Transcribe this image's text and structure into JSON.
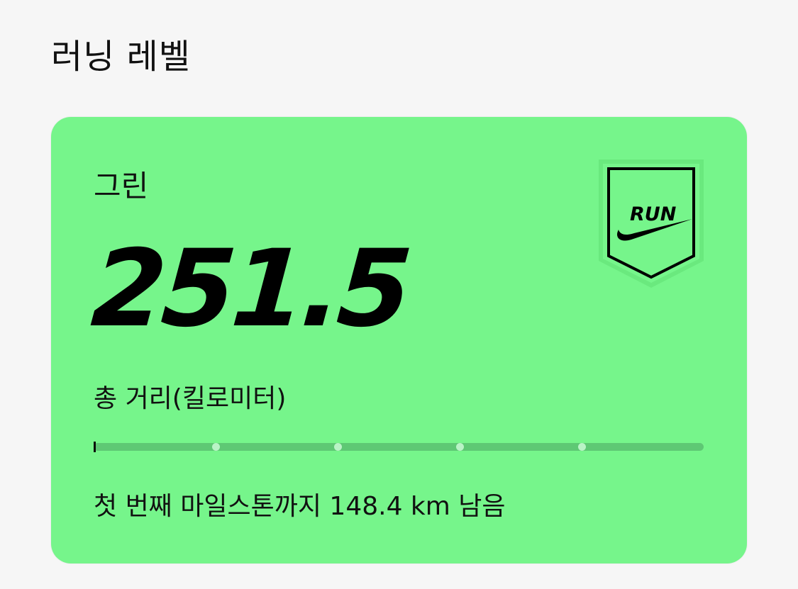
{
  "header": {
    "title": "러닝 레벨"
  },
  "level_card": {
    "level_name": "그린",
    "total_distance": "251.5",
    "distance_label": "총 거리(킬로미터)",
    "remaining_text": "첫 번째 마일스톤까지 148.4 km 남음",
    "progress_fraction": 0.0,
    "milestones_shown": 4,
    "card_color": "#76f58b",
    "track_color": "#5ec874",
    "badge": {
      "icon": "run-badge-icon",
      "label": "RUN",
      "bg_color": "#76f58b"
    }
  }
}
